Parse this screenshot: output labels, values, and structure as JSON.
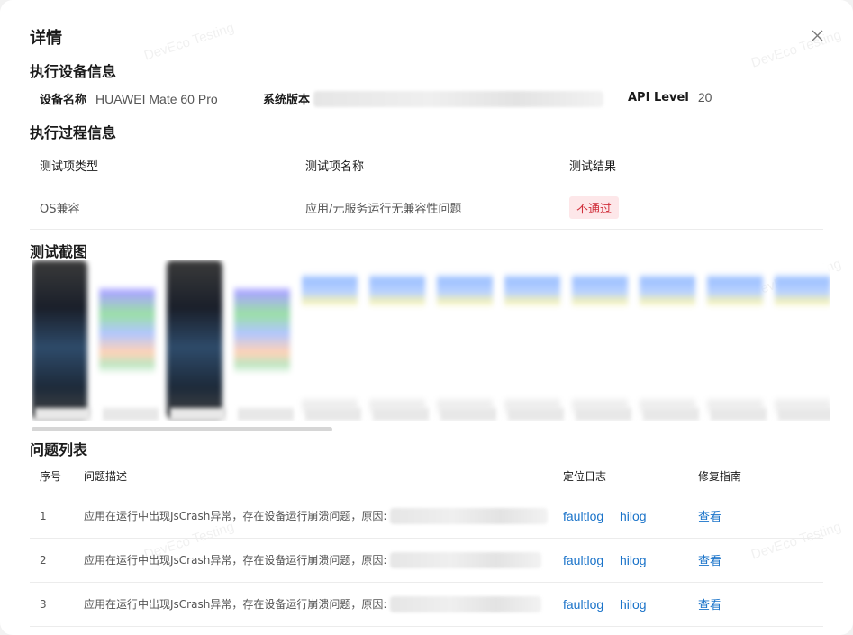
{
  "dialog": {
    "title": "详情",
    "watermark": "DevEco Testing"
  },
  "device_info": {
    "section_title": "执行设备信息",
    "device_name_label": "设备名称",
    "device_name_value": "HUAWEI Mate 60 Pro",
    "system_version_label": "系统版本",
    "api_level_label": "API Level",
    "api_level_value": "20"
  },
  "process_info": {
    "section_title": "执行过程信息",
    "columns": [
      "测试项类型",
      "测试项名称",
      "测试结果"
    ],
    "rows": [
      {
        "type": "OS兼容",
        "name": "应用/元服务运行无兼容性问题",
        "result": "不通过"
      }
    ]
  },
  "screenshots": {
    "section_title": "测试截图",
    "items": [
      "phone",
      "list",
      "phone",
      "list",
      "blue",
      "blue",
      "blue",
      "blue",
      "blue",
      "blue",
      "blue",
      "blue"
    ]
  },
  "issues": {
    "section_title": "问题列表",
    "columns": [
      "序号",
      "问题描述",
      "定位日志",
      "修复指南"
    ],
    "rows": [
      {
        "index": "1",
        "description": "应用在运行中出现JsCrash异常，存在设备运行崩溃问题，原因:",
        "log1": "faultlog",
        "log2": "hilog",
        "guide": "查看"
      },
      {
        "index": "2",
        "description": "应用在运行中出现JsCrash异常，存在设备运行崩溃问题，原因:",
        "log1": "faultlog",
        "log2": "hilog",
        "guide": "查看"
      },
      {
        "index": "3",
        "description": "应用在运行中出现JsCrash异常，存在设备运行崩溃问题，原因:",
        "log1": "faultlog",
        "log2": "hilog",
        "guide": "查看"
      }
    ]
  },
  "colors": {
    "link": "#1a73c9",
    "fail_text": "#d0303c",
    "fail_bg": "#fde7e9"
  }
}
